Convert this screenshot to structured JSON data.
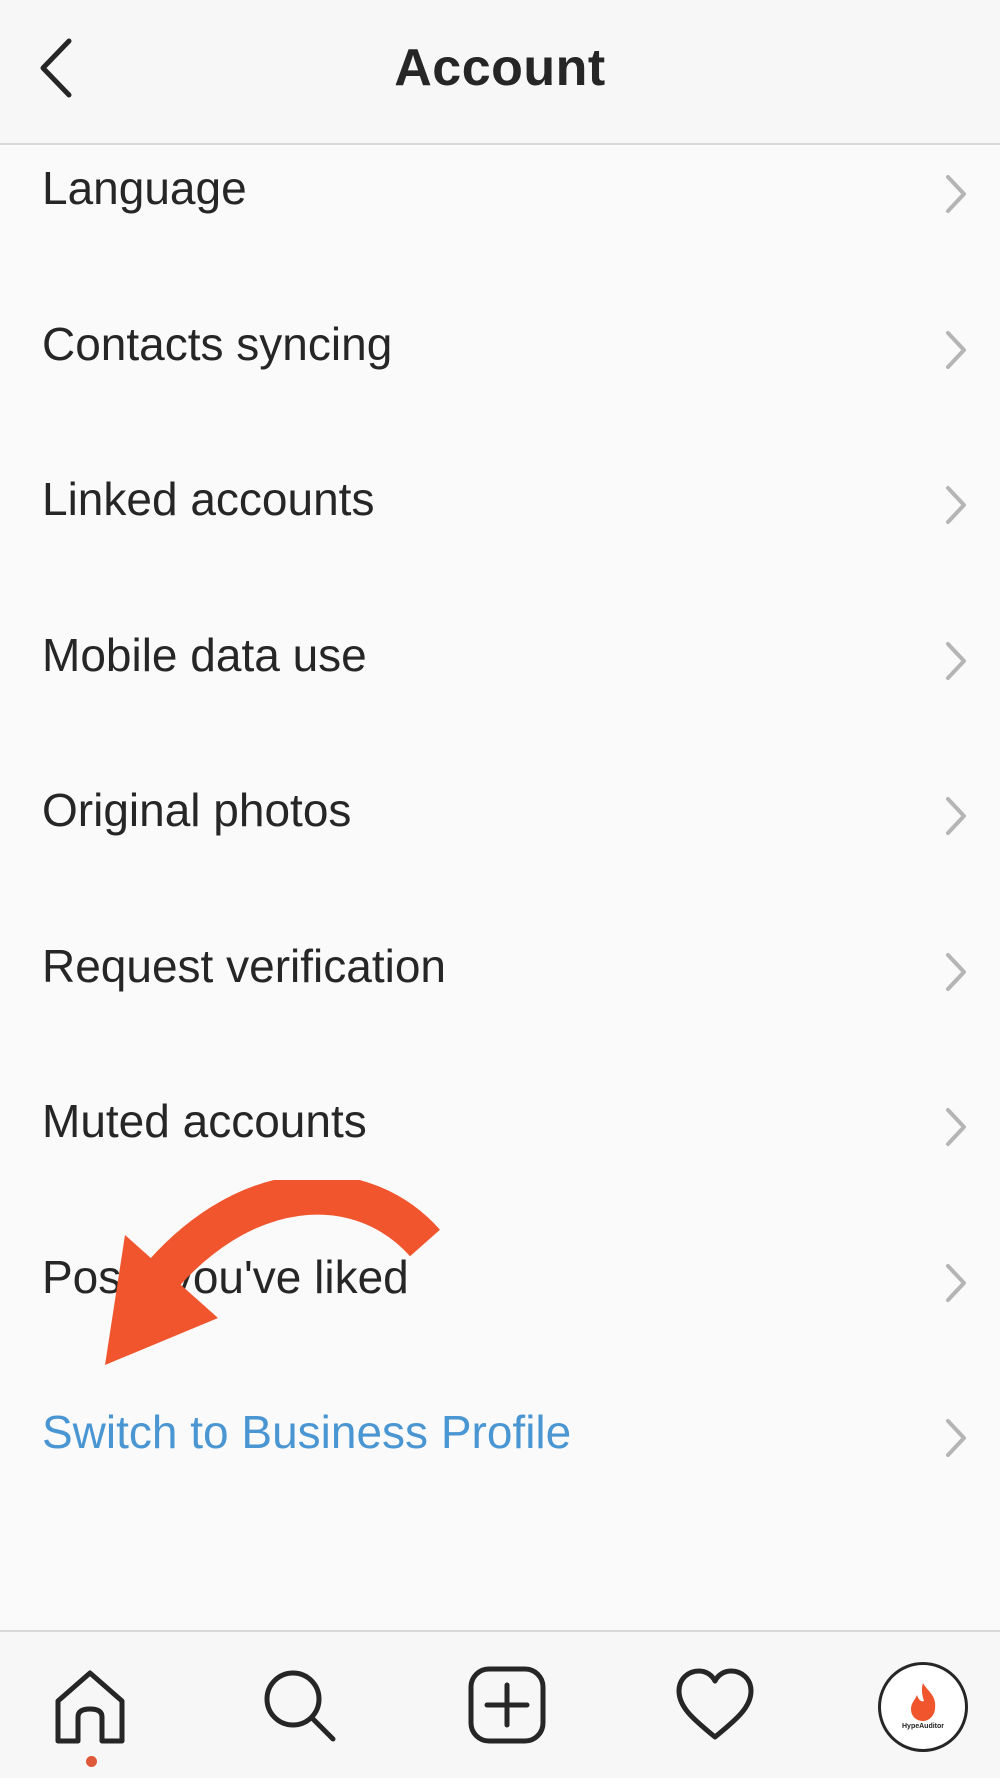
{
  "header": {
    "title": "Account",
    "back_icon": "chevron-left-icon"
  },
  "menu": {
    "items": [
      {
        "label": "Language",
        "style": "default"
      },
      {
        "label": "Contacts syncing",
        "style": "default"
      },
      {
        "label": "Linked accounts",
        "style": "default"
      },
      {
        "label": "Mobile data use",
        "style": "default"
      },
      {
        "label": "Original photos",
        "style": "default"
      },
      {
        "label": "Request verification",
        "style": "default"
      },
      {
        "label": "Muted accounts",
        "style": "default"
      },
      {
        "label": "Posts you've liked",
        "style": "default"
      },
      {
        "label": "Switch to Business Profile",
        "style": "link"
      }
    ],
    "chevron_icon": "chevron-right-icon"
  },
  "tabbar": {
    "tabs": [
      {
        "icon": "home-icon",
        "active": true
      },
      {
        "icon": "search-icon",
        "active": false
      },
      {
        "icon": "add-post-icon",
        "active": false
      },
      {
        "icon": "heart-icon",
        "active": false
      },
      {
        "icon": "profile-avatar",
        "active": false
      }
    ],
    "avatar_brand": "HypeAuditor"
  },
  "annotation": {
    "icon": "curved-arrow-icon",
    "color": "#f0552d"
  },
  "colors": {
    "text": "#262626",
    "link": "#4a96d2",
    "background": "#fafafa",
    "divider": "#d8d8d8",
    "arrow": "#f0552d"
  }
}
